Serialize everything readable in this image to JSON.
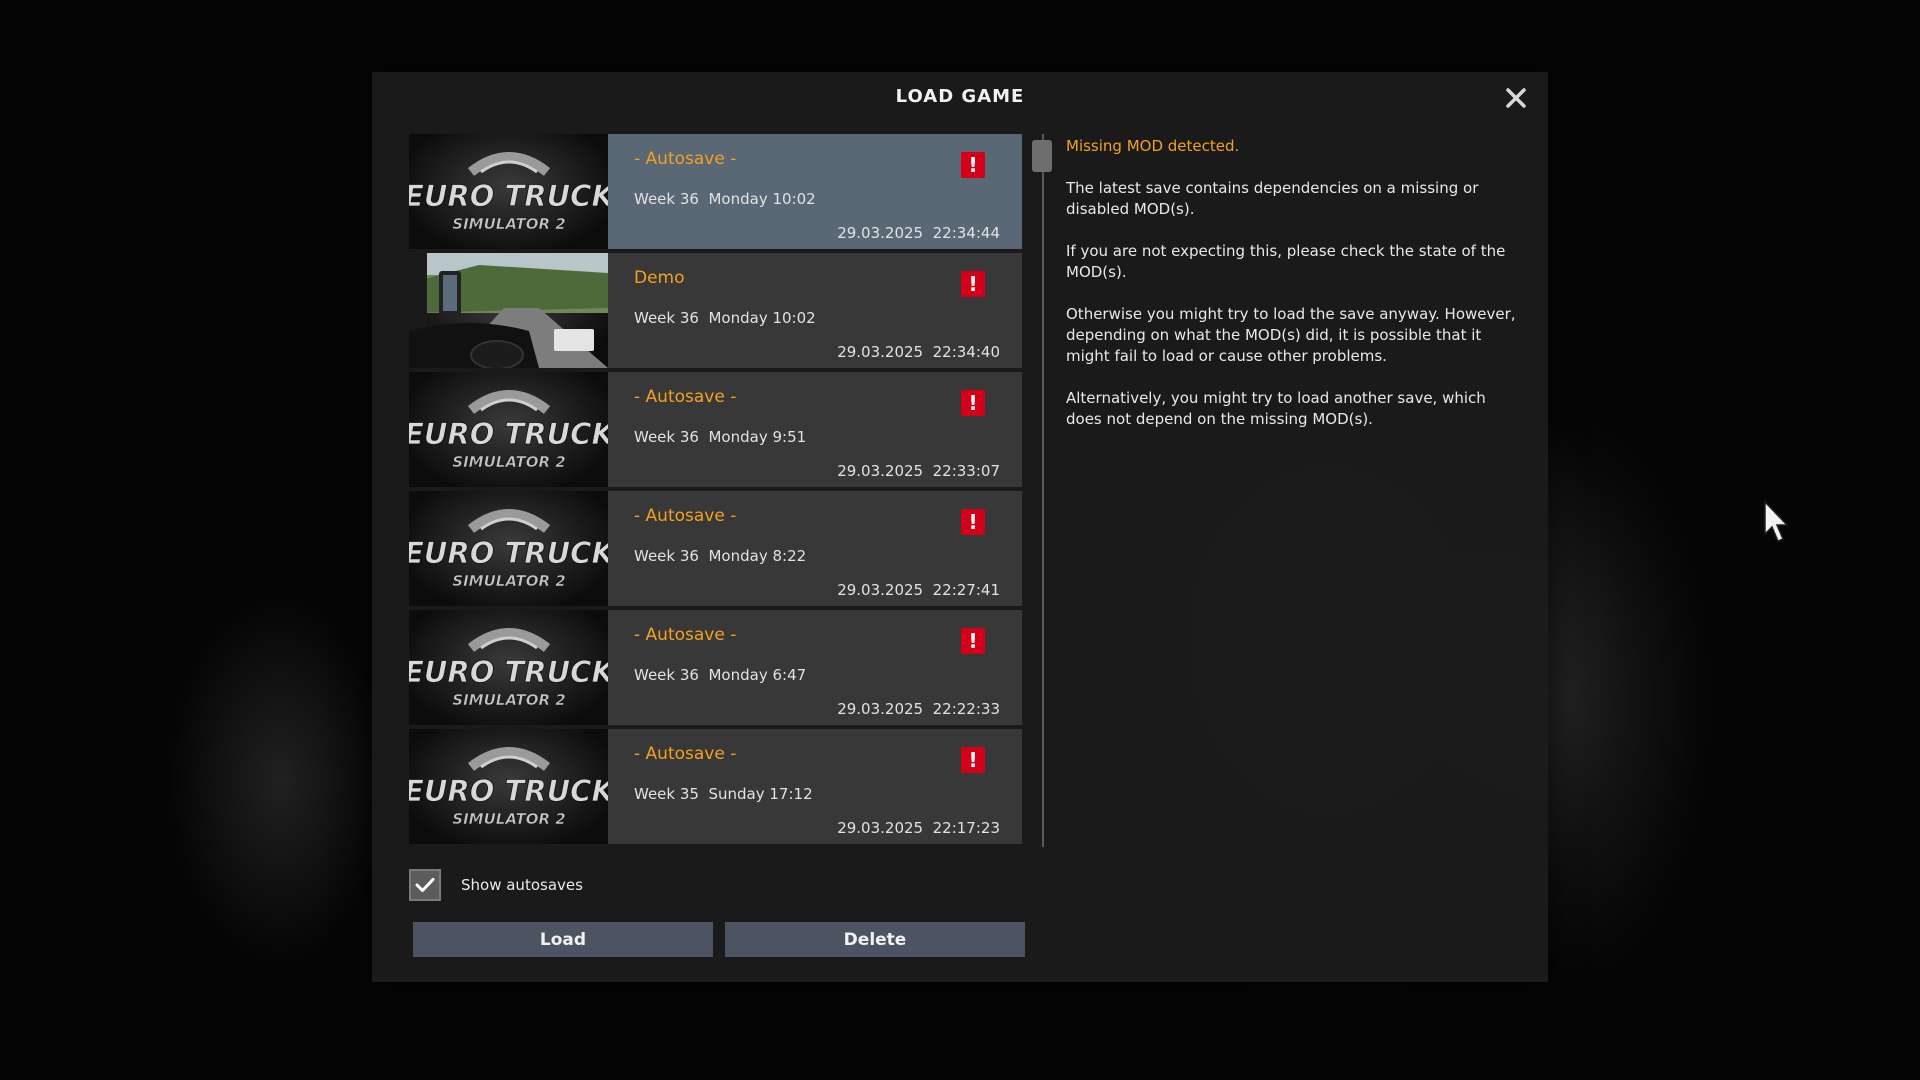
{
  "dialog": {
    "title": "LOAD GAME"
  },
  "colors": {
    "accent": "#f3a21d",
    "selected_row": "#5a6775",
    "row": "#383838",
    "warning": "#d4001a",
    "button": "#4b5460"
  },
  "saves": [
    {
      "title": "- Autosave -",
      "game_time": "Week 36  Monday 10:02",
      "saved": "29.03.2025  22:34:44",
      "thumb": "ets2-logo",
      "selected": true,
      "warning_icon": "missing-mod-warning-icon"
    },
    {
      "title": "Demo",
      "game_time": "Week 36  Monday 10:02",
      "saved": "29.03.2025  22:34:40",
      "thumb": "truck-cab-screenshot",
      "selected": false,
      "warning_icon": "missing-mod-warning-icon"
    },
    {
      "title": "- Autosave -",
      "game_time": "Week 36  Monday 9:51",
      "saved": "29.03.2025  22:33:07",
      "thumb": "ets2-logo",
      "selected": false,
      "warning_icon": "missing-mod-warning-icon"
    },
    {
      "title": "- Autosave -",
      "game_time": "Week 36  Monday 8:22",
      "saved": "29.03.2025  22:27:41",
      "thumb": "ets2-logo",
      "selected": false,
      "warning_icon": "missing-mod-warning-icon"
    },
    {
      "title": "- Autosave -",
      "game_time": "Week 36  Monday 6:47",
      "saved": "29.03.2025  22:22:33",
      "thumb": "ets2-logo",
      "selected": false,
      "warning_icon": "missing-mod-warning-icon"
    },
    {
      "title": "- Autosave -",
      "game_time": "Week 35  Sunday 17:12",
      "saved": "29.03.2025  22:17:23",
      "thumb": "ets2-logo",
      "selected": false,
      "warning_icon": "missing-mod-warning-icon"
    }
  ],
  "logo": {
    "line1": "EURO TRUCK",
    "line2": "SIMULATOR 2"
  },
  "details": {
    "warning_title": "Missing MOD detected.",
    "paragraphs": [
      "The latest save contains dependencies on a missing or disabled MOD(s).",
      "If you are not expecting this, please check the state of the MOD(s).",
      "Otherwise you might try to load the save anyway. However, depending on what the MOD(s) did, it is possible that it might fail to load or cause other problems.",
      "Alternatively, you might try to load another save, which does not depend on the missing MOD(s)."
    ]
  },
  "autosaves": {
    "label": "Show autosaves",
    "checked": true
  },
  "buttons": {
    "load": "Load",
    "delete": "Delete"
  }
}
